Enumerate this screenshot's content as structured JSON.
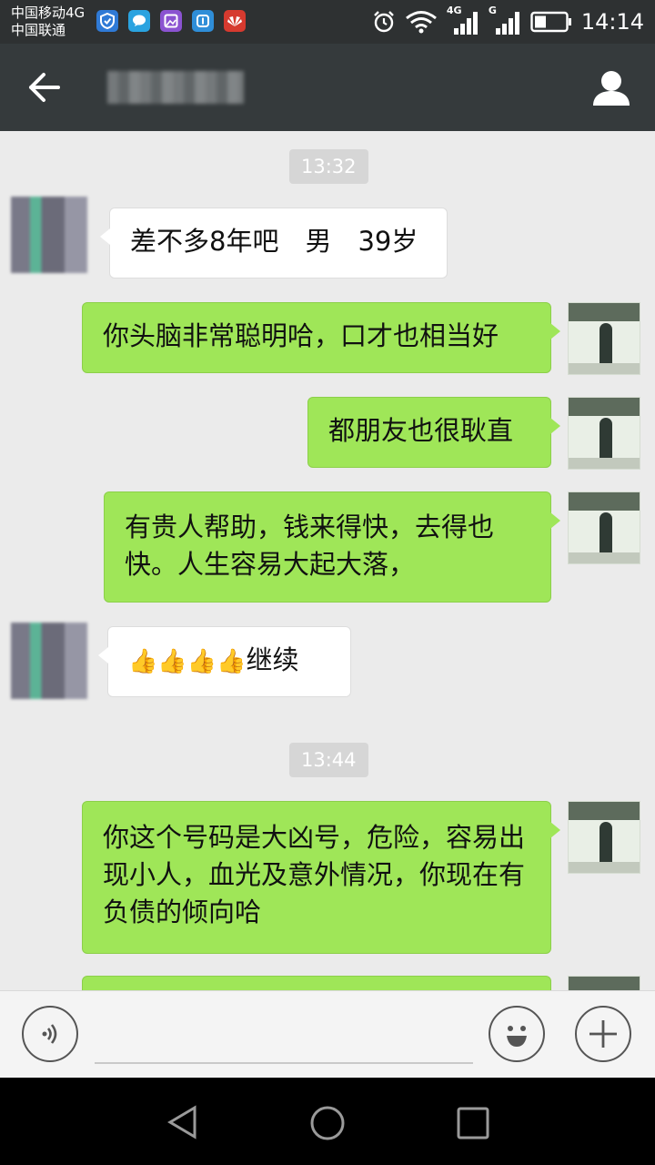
{
  "status": {
    "carrier1": "中国移动4G",
    "carrier2": "中国联通",
    "net1": "4G",
    "net2": "G",
    "time": "14:14"
  },
  "header": {
    "back_icon": "arrow-left-icon",
    "profile_icon": "person-icon"
  },
  "chat": {
    "timestamp1": "13:32",
    "timestamp2": "13:44",
    "messages": [
      {
        "dir": "in",
        "text": "差不多8年吧　男　39岁"
      },
      {
        "dir": "out",
        "text": "你头脑非常聪明哈，口才也相当好"
      },
      {
        "dir": "out",
        "text": "都朋友也很耿直"
      },
      {
        "dir": "out",
        "text": "有贵人帮助，钱来得快，去得也快。人生容易大起大落，"
      },
      {
        "dir": "in",
        "text": "继续",
        "emoji": "👍👍👍👍"
      },
      {
        "dir": "out",
        "text": "你这个号码是大凶号，危险，容易出现小人，血光及意外情况，你现在有负债的倾向哈"
      }
    ]
  },
  "input": {
    "voice_icon": "voice-icon",
    "emoji_icon": "smiley-icon",
    "more_icon": "plus-icon"
  },
  "nav": {
    "back_icon": "triangle-back-icon",
    "home_icon": "circle-home-icon",
    "recent_icon": "square-recent-icon"
  },
  "colors": {
    "outgoing": "#9fe658",
    "incoming": "#ffffff",
    "background": "#ebebeb",
    "titlebar": "#353a3c"
  }
}
